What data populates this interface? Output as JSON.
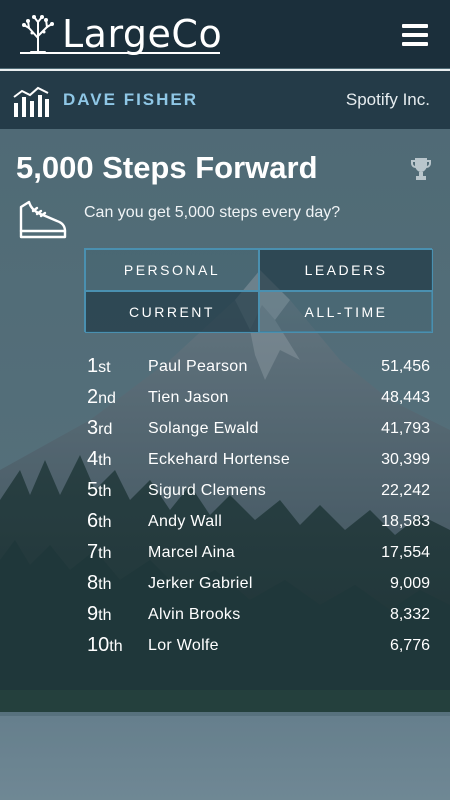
{
  "header": {
    "brand": "LargeCo",
    "menu_icon": "hamburger-menu-icon"
  },
  "userbar": {
    "icon": "bar-chart-icon",
    "user_name": "DAVE FISHER",
    "company": "Spotify Inc."
  },
  "challenge": {
    "title": "5,000 Steps Forward",
    "description": "Can you get 5,000 steps every day?",
    "trophy_icon": "trophy-icon",
    "shoe_icon": "sneaker-icon"
  },
  "tabs": {
    "personal": "PERSONAL",
    "leaders": "LEADERS",
    "current": "CURRENT",
    "all_time": "ALL-TIME"
  },
  "leaders": [
    {
      "num": "1",
      "suf": "st",
      "name": "Paul Pearson",
      "steps": "51,456"
    },
    {
      "num": "2",
      "suf": "nd",
      "name": "Tien Jason",
      "steps": "48,443"
    },
    {
      "num": "3",
      "suf": "rd",
      "name": "Solange Ewald",
      "steps": "41,793"
    },
    {
      "num": "4",
      "suf": "th",
      "name": "Eckehard Hortense",
      "steps": "30,399"
    },
    {
      "num": "5",
      "suf": "th",
      "name": "Sigurd Clemens",
      "steps": "22,242"
    },
    {
      "num": "6",
      "suf": "th",
      "name": "Andy Wall",
      "steps": "18,583"
    },
    {
      "num": "7",
      "suf": "th",
      "name": "Marcel Aina",
      "steps": "17,554"
    },
    {
      "num": "8",
      "suf": "th",
      "name": "Jerker Gabriel",
      "steps": "9,009"
    },
    {
      "num": "9",
      "suf": "th",
      "name": "Alvin Brooks",
      "steps": "8,332"
    },
    {
      "num": "10",
      "suf": "th",
      "name": "Lor Wolfe",
      "steps": "6,776"
    }
  ]
}
